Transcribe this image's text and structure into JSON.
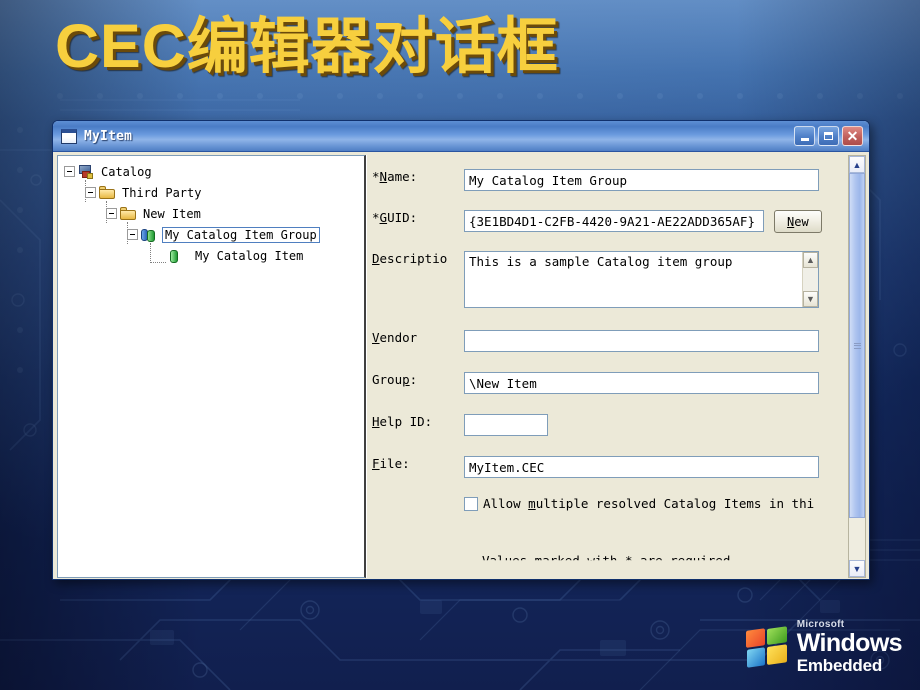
{
  "slide": {
    "title": "CEC编辑器对话框",
    "title_color": "#f7cf3e",
    "background_color": "#16306a"
  },
  "dialog": {
    "titlebar": {
      "title": "MyItem",
      "icon": "window-icon",
      "buttons": {
        "minimize": "minimize-icon",
        "maximize": "maximize-icon",
        "close": "close-icon"
      }
    },
    "tree": {
      "nodes": [
        {
          "label": "Catalog",
          "icon": "catalog-icon",
          "depth": 0,
          "expanded": true,
          "selected": false
        },
        {
          "label": "Third Party",
          "icon": "folder-icon",
          "depth": 1,
          "expanded": true,
          "selected": false
        },
        {
          "label": "New Item",
          "icon": "folder-icon",
          "depth": 2,
          "expanded": true,
          "selected": false
        },
        {
          "label": "My Catalog Item Group",
          "icon": "catalog-group-icon",
          "depth": 3,
          "expanded": true,
          "selected": true
        },
        {
          "label": "My Catalog Item",
          "icon": "catalog-item-icon",
          "depth": 4,
          "expanded": false,
          "selected": false
        }
      ]
    },
    "form": {
      "name": {
        "label_prefix": "*",
        "label_accel": "N",
        "label_rest": "ame:",
        "value": "My Catalog Item Group"
      },
      "guid": {
        "label_prefix": "*",
        "label_accel": "G",
        "label_rest": "UID:",
        "value": "{3E1BD4D1-C2FB-4420-9A21-AE22ADD365AF}",
        "button_accel": "N",
        "button_rest": "ew"
      },
      "description": {
        "label_accel": "D",
        "label_rest": "escriptio",
        "value": "This is a sample Catalog item group",
        "scroll_up": "scroll-up-icon",
        "scroll_down": "scroll-down-icon"
      },
      "vendor": {
        "label_accel": "V",
        "label_rest": "endor",
        "value": ""
      },
      "group": {
        "label_pre": "Grou",
        "label_accel": "p",
        "label_rest": ":",
        "value": "\\New Item"
      },
      "help_id": {
        "label_accel": "H",
        "label_rest": "elp ID:",
        "value": ""
      },
      "file": {
        "label_accel": "F",
        "label_rest": "ile:",
        "value": "MyItem.CEC"
      },
      "allow_multiple": {
        "checked": false,
        "text_pre": "Allow ",
        "text_accel": "m",
        "text_rest": "ultiple resolved Catalog Items in thi"
      },
      "required_note": "Values marked with * are required"
    },
    "scrollbar": {
      "up": "scroll-up-icon",
      "down": "scroll-down-icon"
    }
  },
  "logo": {
    "microsoft": "Microsoft",
    "windows": "Windows",
    "embedded": "Embedded"
  }
}
